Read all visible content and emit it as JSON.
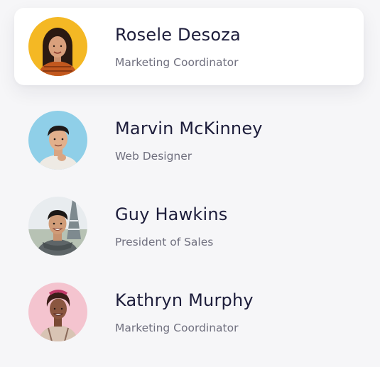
{
  "people": [
    {
      "name": "Rosele Desoza",
      "role": "Marketing Coordinator",
      "avatar_icon": "avatar-woman-yellow-bg"
    },
    {
      "name": "Marvin McKinney",
      "role": "Web Designer",
      "avatar_icon": "avatar-man-blue-bg"
    },
    {
      "name": "Guy Hawkins",
      "role": "President of Sales",
      "avatar_icon": "avatar-man-eiffel-tower-bg"
    },
    {
      "name": "Kathryn Murphy",
      "role": "Marketing Coordinator",
      "avatar_icon": "avatar-woman-pink-bg"
    }
  ],
  "colors": {
    "background": "#f6f6f8",
    "card": "#ffffff",
    "name_text": "#1d1d3b",
    "role_text": "#70707f"
  }
}
